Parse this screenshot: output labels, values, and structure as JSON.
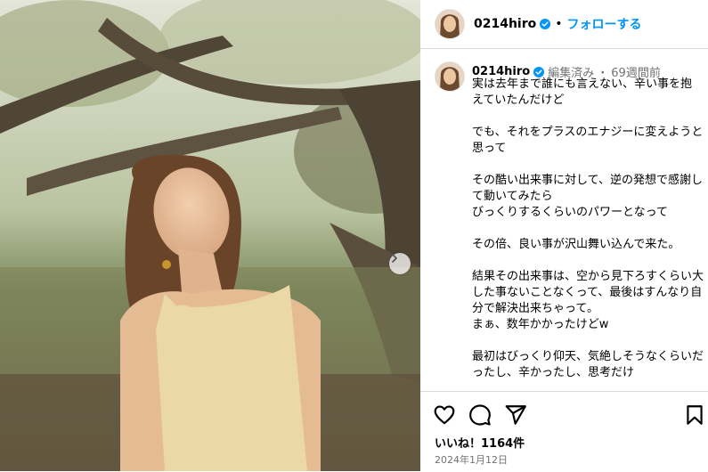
{
  "post": {
    "username": "0214hiro",
    "follow_label": "フォローする",
    "header_separator": "•",
    "edited_label": "編集済み",
    "caption_separator": "・",
    "time_ago": "69週間前",
    "caption": "実は去年まで誰にも言えない、辛い事を抱えていたんだけど\n\nでも、それをプラスのエナジーに変えようと思って\n\nその酷い出来事に対して、逆の発想で感謝して動いてみたら\nびっくりするくらいのパワーとなって\n\nその倍、良い事が沢山舞い込んで来た。\n\n結果その出来事は、空から見下ろすくらい大した事ないことなくって、最後はすんなり自分で解決出来ちゃって。\nまぁ、数年かかったけどw\n\n最初はびっくり仰天、気絶しそうなくらいだったし、辛かったし、思考だけ",
    "likes_label": "いいね！1164件",
    "date": "2024年1月12日"
  },
  "colors": {
    "accent": "#0095f6",
    "verified": "#0095f6",
    "muted": "#737373",
    "divider": "#dbdbdb"
  },
  "icons": {
    "like": "heart-icon",
    "comment": "comment-icon",
    "share": "paper-plane-icon",
    "save": "bookmark-icon",
    "next": "chevron-right-icon",
    "verified": "verified-badge-icon"
  }
}
